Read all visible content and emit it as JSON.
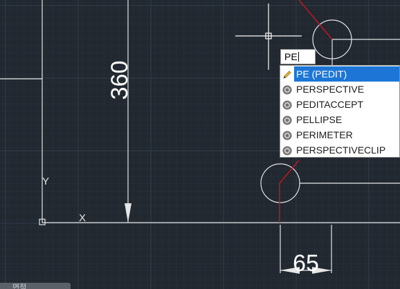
{
  "canvas": {
    "background": "#212830",
    "grid_minor": "#2b333c",
    "grid_major": "#36404a",
    "line_color": "#e6e6e6",
    "red_line_color": "#c8161e",
    "dim_vertical": "360",
    "dim_horizontal": "65",
    "ucs_y_label": "Y",
    "ucs_x_label": "X"
  },
  "command_line": {
    "input_value": "PE"
  },
  "autocomplete": {
    "items": [
      {
        "label": "PE (PEDIT)",
        "icon": "pencil-icon",
        "selected": true
      },
      {
        "label": "PERSPECTIVE",
        "icon": "gear-icon",
        "selected": false
      },
      {
        "label": "PEDITACCEPT",
        "icon": "gear-icon",
        "selected": false
      },
      {
        "label": "PELLIPSE",
        "icon": "gear-icon",
        "selected": false
      },
      {
        "label": "PERIMETER",
        "icon": "gear-icon",
        "selected": false
      },
      {
        "label": "PERSPECTIVECLIP",
        "icon": "gear-icon",
        "selected": false
      }
    ],
    "selected_color": "#1d76d6"
  },
  "status_tag": {
    "label": "면적"
  }
}
